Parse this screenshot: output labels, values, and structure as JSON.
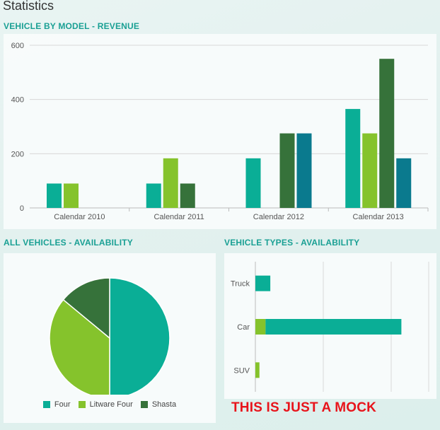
{
  "page": {
    "title": "Statistics"
  },
  "colors": {
    "Four": "#0aae96",
    "Litware Four": "#85c32c",
    "Shasta": "#36723a",
    "Fourth": "#0a7a8e"
  },
  "revenue_panel": {
    "title": "VEHICLE BY MODEL - REVENUE"
  },
  "all_vehicles_panel": {
    "title": "ALL VEHICLES - AVAILABILITY"
  },
  "vehicle_types_panel": {
    "title": "VEHICLE TYPES - AVAILABILITY"
  },
  "mock_label": "THIS IS JUST A MOCK",
  "chart_data": [
    {
      "type": "bar",
      "title": "VEHICLE BY MODEL - REVENUE",
      "categories": [
        "Calendar 2010",
        "Calendar 2011",
        "Calendar 2012",
        "Calendar 2013"
      ],
      "series": [
        {
          "values": [
            90,
            90,
            183,
            365
          ]
        },
        {
          "values": [
            90,
            183,
            0,
            275
          ]
        },
        {
          "values": [
            0,
            90,
            275,
            550
          ]
        },
        {
          "values": [
            0,
            0,
            275,
            183
          ]
        }
      ],
      "ylim": [
        0,
        600
      ],
      "yticks": [
        "0",
        "200",
        "400",
        "600"
      ],
      "grid": true
    },
    {
      "type": "pie",
      "title": "ALL VEHICLES - AVAILABILITY",
      "labels": [
        "Four",
        "Litware Four",
        "Shasta"
      ],
      "values": [
        50,
        36,
        14
      ],
      "legend": "bottom"
    },
    {
      "type": "bar",
      "orientation": "horizontal",
      "stacked": true,
      "title": "VEHICLE TYPES - AVAILABILITY",
      "categories": [
        "Truck",
        "SUV",
        "Car"
      ],
      "display_order": [
        "Truck",
        "Car",
        "SUV"
      ],
      "series": [
        {
          "name": "Four",
          "values": [
            22,
            0,
            200
          ]
        },
        {
          "name": "Litware Four",
          "values": [
            0,
            6,
            15
          ]
        }
      ],
      "xlim": [
        0,
        250
      ],
      "grid": true
    }
  ]
}
